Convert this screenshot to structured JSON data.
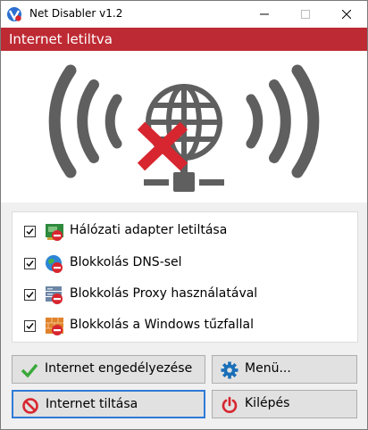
{
  "window": {
    "title": "Net Disabler v1.2",
    "controls": {
      "minimize": "minimize",
      "maximize": "maximize",
      "close": "close"
    }
  },
  "header": {
    "status": "Internet letiltva"
  },
  "hero": {
    "icon": "globe-disconnected-icon",
    "state": "disabled"
  },
  "options": [
    {
      "label": "Hálózati adapter letiltása",
      "checked": true,
      "icon": "network-adapter-icon"
    },
    {
      "label": "Blokkolás DNS-sel",
      "checked": true,
      "icon": "dns-globe-icon"
    },
    {
      "label": "Blokkolás Proxy használatával",
      "checked": true,
      "icon": "proxy-server-icon"
    },
    {
      "label": "Blokkolás a Windows tűzfallal",
      "checked": true,
      "icon": "firewall-icon"
    }
  ],
  "buttons": {
    "enable": {
      "label": "Internet engedélyezése",
      "icon": "checkmark-icon"
    },
    "menu": {
      "label": "Menü...",
      "icon": "gear-icon"
    },
    "disable": {
      "label": "Internet tiltása",
      "icon": "prohibited-icon"
    },
    "exit": {
      "label": "Kilépés",
      "icon": "power-icon"
    }
  },
  "colors": {
    "header_bg": "#be2a33",
    "accent_red": "#d7262f",
    "check_green": "#3aa83a",
    "gear_blue": "#1a6fb8",
    "focus_blue": "#2f7ad8"
  }
}
